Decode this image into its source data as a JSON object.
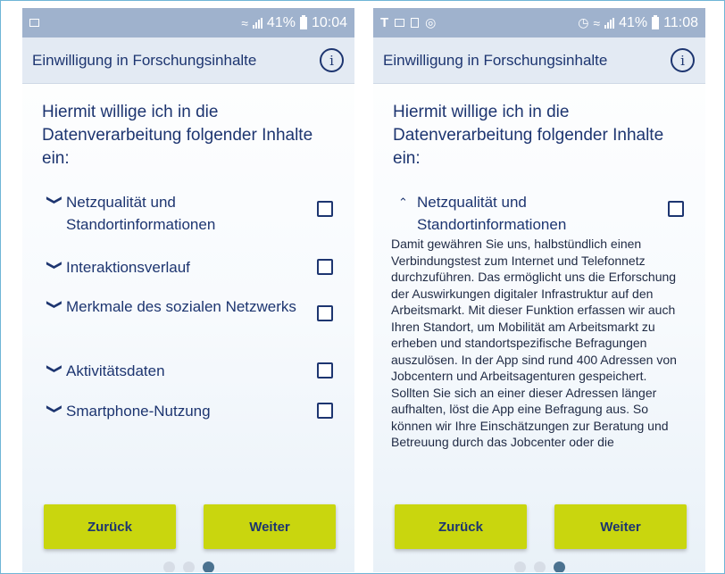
{
  "left_screen": {
    "status": {
      "battery": "41%",
      "time": "10:04"
    },
    "title": "Einwilligung in Forschungsinhalte",
    "intro": "Hiermit willige ich in die Datenverarbeitung folgender Inhalte ein:",
    "items": [
      {
        "label": "Netzqualität und Standortinformationen",
        "expanded": false,
        "checked": false
      },
      {
        "label": "Interaktionsverlauf",
        "expanded": false,
        "checked": false
      },
      {
        "label": "Merkmale des sozialen Netzwerks",
        "expanded": false,
        "checked": false
      },
      {
        "label": "Aktivitätsdaten",
        "expanded": false,
        "checked": false
      },
      {
        "label": "Smartphone-Nutzung",
        "expanded": false,
        "checked": false
      }
    ],
    "back_label": "Zurück",
    "next_label": "Weiter",
    "page_indicator": {
      "total": 3,
      "active": 3
    }
  },
  "right_screen": {
    "status": {
      "battery": "41%",
      "time": "11:08"
    },
    "title": "Einwilligung in Forschungsinhalte",
    "intro": "Hiermit willige ich in die Datenverarbeitung folgender Inhalte ein:",
    "items": [
      {
        "label": "Netzqualität und Standortinformationen",
        "expanded": true,
        "checked": false
      }
    ],
    "expanded_text": "Damit gewähren Sie uns, halbstündlich einen Verbindungstest zum Internet und Telefonnetz durchzuführen. Das ermöglicht uns die Erforschung der Auswirkungen digitaler Infrastruktur auf den Arbeitsmarkt. Mit dieser Funktion erfassen wir auch Ihren Standort, um Mobilität am Arbeitsmarkt zu erheben und standortspezifische Befragungen auszulösen. In der App sind rund 400 Adressen von Jobcentern und Arbeitsagenturen gespeichert. Sollten Sie sich an einer dieser Adressen länger aufhalten, löst die App eine Befragung aus. So können wir Ihre Einschätzungen zur Beratung und Betreuung durch das Jobcenter oder die",
    "back_label": "Zurück",
    "next_label": "Weiter",
    "page_indicator": {
      "total": 3,
      "active": 3
    }
  },
  "icons": {
    "info": "info-circle-icon",
    "collapsed": "chevron-down-icon",
    "expanded": "chevron-up-icon"
  },
  "colors": {
    "status_bar": "#9fb2cd",
    "title_bar": "#e3eaf3",
    "text_primary": "#1d3570",
    "button": "#c9d60e",
    "dot_active": "#4b7290",
    "dot_inactive": "#d7dde6"
  }
}
